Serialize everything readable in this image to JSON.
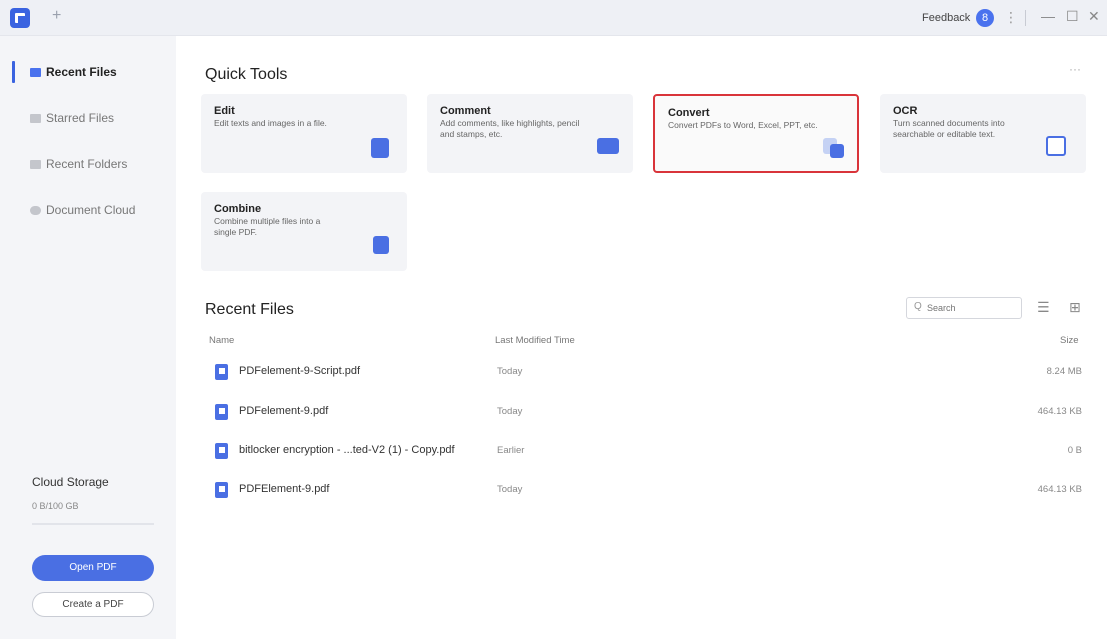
{
  "titlebar": {
    "new_tab_glyph": "+",
    "feedback_label": "Feedback",
    "avatar_glyph": "8",
    "menu_glyph": "⋮",
    "minimize_glyph": "—",
    "maximize_glyph": "☐",
    "close_glyph": "✕"
  },
  "sidebar": {
    "items": [
      {
        "label": "Recent Files",
        "icon": "recent-files-icon"
      },
      {
        "label": "Starred Files",
        "icon": "starred-files-icon"
      },
      {
        "label": "Recent Folders",
        "icon": "folder-icon"
      },
      {
        "label": "Document Cloud",
        "icon": "cloud-icon"
      }
    ],
    "cloud_title": "Cloud Storage",
    "cloud_used": "0 B/100 GB",
    "open_pdf": "Open PDF",
    "create_pdf": "Create a PDF"
  },
  "quick_tools": {
    "title": "Quick Tools",
    "more_glyph": "···",
    "tools": [
      {
        "title": "Edit",
        "desc": "Edit texts and images in a file.",
        "icon": "edit-icon"
      },
      {
        "title": "Comment",
        "desc": "Add comments, like highlights, pencil and stamps, etc.",
        "icon": "comment-icon"
      },
      {
        "title": "Convert",
        "desc": "Convert PDFs to Word, Excel, PPT, etc.",
        "icon": "convert-icon"
      },
      {
        "title": "OCR",
        "desc": "Turn scanned documents into searchable or editable text.",
        "icon": "ocr-icon"
      },
      {
        "title": "Combine",
        "desc": "Combine multiple files into a single PDF.",
        "icon": "combine-icon"
      }
    ]
  },
  "recent_files": {
    "title": "Recent Files",
    "search_placeholder": "Search",
    "search_glyph": "Q",
    "list_view_glyph": "☰",
    "grid_view_glyph": "⊞",
    "columns": {
      "name": "Name",
      "modified": "Last Modified Time",
      "size": "Size"
    },
    "rows": [
      {
        "name": "PDFelement-9-Script.pdf",
        "modified": "Today",
        "size": "8.24 MB"
      },
      {
        "name": "PDFelement-9.pdf",
        "modified": "Today",
        "size": "464.13 KB"
      },
      {
        "name": "bitlocker encryption - ...ted-V2 (1) - Copy.pdf",
        "modified": "Earlier",
        "size": "0 B"
      },
      {
        "name": "PDFElement-9.pdf",
        "modified": "Today",
        "size": "464.13 KB"
      }
    ]
  },
  "colors": {
    "accent": "#4a6fe3",
    "selected_border": "#d9343a"
  }
}
